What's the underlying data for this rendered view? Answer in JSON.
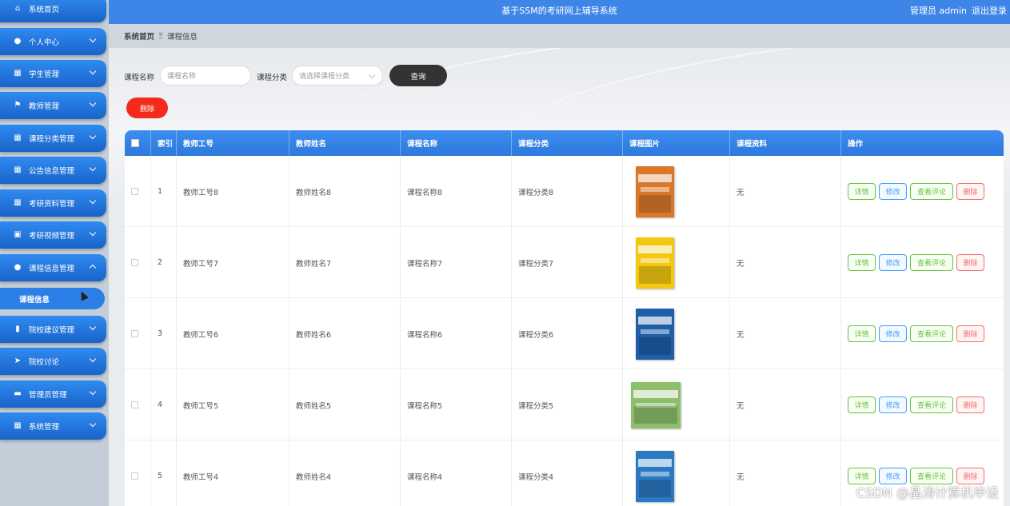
{
  "header": {
    "title": "基于SSM的考研网上辅导系统",
    "admin": "管理员 admin",
    "logout": "退出登录"
  },
  "sidebar": {
    "items": [
      {
        "label": "系统首页",
        "icon": "home-icon"
      },
      {
        "label": "个人中心",
        "icon": "user-icon"
      },
      {
        "label": "学生管理",
        "icon": "grid-icon"
      },
      {
        "label": "教师管理",
        "icon": "flag-icon"
      },
      {
        "label": "课程分类管理",
        "icon": "grid-icon"
      },
      {
        "label": "公告信息管理",
        "icon": "grid-icon"
      },
      {
        "label": "考研资料管理",
        "icon": "grid-icon"
      },
      {
        "label": "考研视频管理",
        "icon": "clipboard-icon"
      },
      {
        "label": "课程信息管理",
        "icon": "location-icon"
      },
      {
        "label": "院校建议管理",
        "icon": "bar-chart-icon"
      },
      {
        "label": "院校讨论",
        "icon": "send-icon"
      },
      {
        "label": "管理员管理",
        "icon": "briefcase-icon"
      },
      {
        "label": "系统管理",
        "icon": "grid-icon"
      }
    ],
    "active_sub": "课程信息"
  },
  "breadcrumb": {
    "home": "系统首页",
    "sep": "Ξ",
    "current": "课程信息"
  },
  "search": {
    "name_label": "课程名称",
    "name_placeholder": "课程名称",
    "category_label": "课程分类",
    "category_placeholder": "请选择课程分类",
    "query_button": "查询",
    "delete_button": "删除"
  },
  "table": {
    "columns": [
      "索引",
      "教师工号",
      "教师姓名",
      "课程名称",
      "课程分类",
      "课程图片",
      "课程资料",
      "操作"
    ],
    "rows": [
      {
        "index": "1",
        "teacher_id": "教师工号8",
        "teacher_name": "教师姓名8",
        "course_name": "课程名称8",
        "category": "课程分类8",
        "material": "无",
        "cover_color": "#d9782a"
      },
      {
        "index": "2",
        "teacher_id": "教师工号7",
        "teacher_name": "教师姓名7",
        "course_name": "课程名称7",
        "category": "课程分类7",
        "material": "无",
        "cover_color": "#f2c811"
      },
      {
        "index": "3",
        "teacher_id": "教师工号6",
        "teacher_name": "教师姓名6",
        "course_name": "课程名称6",
        "category": "课程分类6",
        "material": "无",
        "cover_color": "#1e5fa8"
      },
      {
        "index": "4",
        "teacher_id": "教师工号5",
        "teacher_name": "教师姓名5",
        "course_name": "课程名称5",
        "category": "课程分类5",
        "material": "无",
        "cover_color": "#8dbf6b"
      },
      {
        "index": "5",
        "teacher_id": "教师工号4",
        "teacher_name": "教师姓名4",
        "course_name": "课程名称4",
        "category": "课程分类4",
        "material": "无",
        "cover_color": "#2a79c2"
      }
    ],
    "actions": {
      "detail": "详情",
      "edit": "修改",
      "comments": "查看评论",
      "delete": "删除"
    }
  },
  "watermark": "CSDN @晶涛计算机毕设",
  "colors": {
    "primary": "#2f8bf0",
    "danger": "#f42a1b",
    "success": "#67c23a"
  }
}
